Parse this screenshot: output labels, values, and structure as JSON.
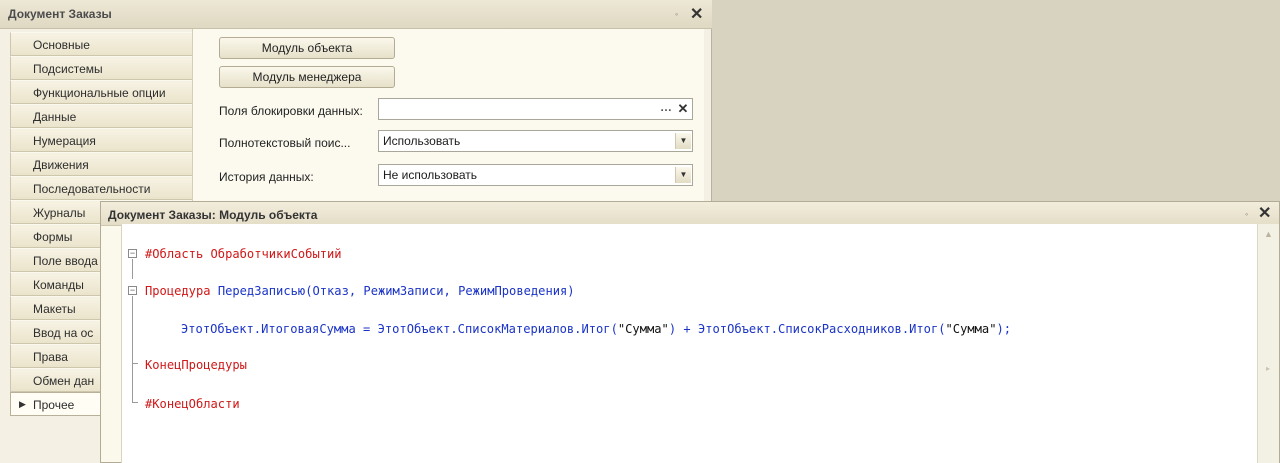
{
  "main_window": {
    "title": "Документ Заказы",
    "tabs": [
      {
        "label": "Основные"
      },
      {
        "label": "Подсистемы"
      },
      {
        "label": "Функциональные опции"
      },
      {
        "label": "Данные"
      },
      {
        "label": "Нумерация"
      },
      {
        "label": "Движения"
      },
      {
        "label": "Последовательности"
      },
      {
        "label": "Журналы"
      },
      {
        "label": "Формы"
      },
      {
        "label": "Поле ввода"
      },
      {
        "label": "Команды"
      },
      {
        "label": "Макеты"
      },
      {
        "label": "Ввод на ос"
      },
      {
        "label": "Права"
      },
      {
        "label": "Обмен дан"
      },
      {
        "label": "Прочее"
      }
    ],
    "selected_tab": "Прочее",
    "buttons": {
      "object_module": "Модуль объекта",
      "manager_module": "Модуль менеджера"
    },
    "fields": {
      "lock_fields_label": "Поля блокировки данных:",
      "lock_fields_value": "",
      "fulltext_label": "Полнотекстовый поис...",
      "fulltext_value": "Использовать",
      "history_label": "История данных:",
      "history_value": "Не использовать"
    }
  },
  "module_window": {
    "title": "Документ Заказы: Модуль объекта",
    "code": {
      "line1": "#Область ОбработчикиСобытий",
      "line2_kw": "Процедура",
      "line2_name": "ПередЗаписью",
      "line2_params": "(Отказ, РежимЗаписи, РежимПроведения)",
      "line3_a": "ЭтотОбъект.ИтоговаяСумма = ЭтотОбъект.СписокМатериалов.Итог(",
      "line3_s1": "\"Сумма\"",
      "line3_b": ") + ЭтотОбъект.СписокРасходников.Итог(",
      "line3_s2": "\"Сумма\"",
      "line3_c": ");",
      "line4": "КонецПроцедуры",
      "line5": "#КонецОбласти"
    }
  },
  "icons": {
    "pin": "pin-icon",
    "close": "close-icon",
    "dropdown": "chevron-down-icon",
    "select": "ellipsis-icon",
    "clear": "clear-icon",
    "fold": "fold-minus-icon"
  },
  "colors": {
    "keyword": "#d01818",
    "identifier": "#1b34c7",
    "string": "#111111"
  }
}
